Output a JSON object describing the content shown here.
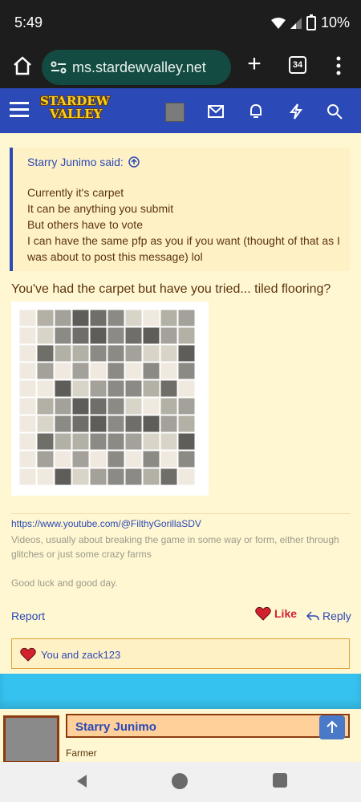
{
  "status": {
    "time": "5:49",
    "battery": "10%"
  },
  "browser": {
    "url": "ms.stardewvalley.net",
    "tabs_count": "34"
  },
  "site": {
    "logo_line1": "STARDEW",
    "logo_line2": "VALLEY"
  },
  "quote": {
    "author_said": "Starry Junimo said:",
    "lines": [
      "Currently it's carpet",
      "It can be anything you submit",
      "But others have to vote",
      "I can have the same pfp as you if you want (thought of that as I was about to post this message) lol"
    ]
  },
  "post": {
    "text": "You've had the carpet but have you tried... tiled flooring?"
  },
  "signature": {
    "link": "https://www.youtube.com/@FilthyGorillaSDV",
    "text": "Videos, usually about breaking the game in some way or form, either through glitches or just some crazy farms",
    "luck": "Good luck and good day."
  },
  "actions": {
    "report": "Report",
    "like": "Like",
    "reply": "Reply"
  },
  "likes": {
    "text": "You and zack123"
  },
  "next_post": {
    "username": "Starry Junimo",
    "role": "Farmer"
  },
  "colors": {
    "accent": "#2b49b7",
    "header": "#2b49b7",
    "like": "#d3222f"
  }
}
